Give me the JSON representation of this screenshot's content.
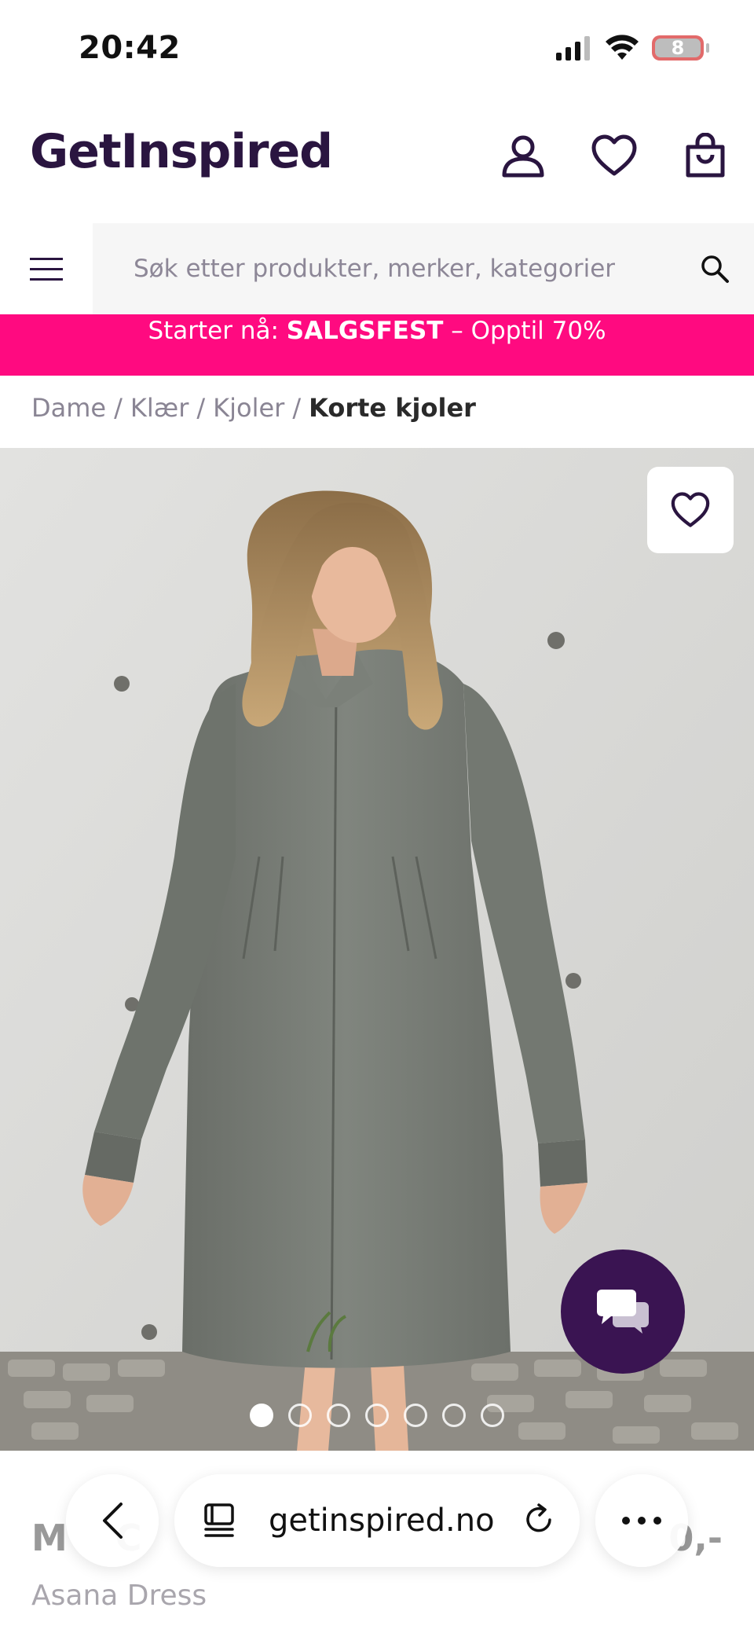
{
  "status_bar": {
    "time": "20:42",
    "battery_level": "8",
    "icons": [
      "signal-icon",
      "wifi-icon",
      "battery-icon"
    ]
  },
  "header": {
    "logo": "GetInspired",
    "icons": [
      "account-icon",
      "heart-icon",
      "bag-icon"
    ]
  },
  "search": {
    "placeholder": "Søk etter produkter, merker, kategorier"
  },
  "promo": {
    "prefix": "Starter nå: ",
    "highlight": "SALGSFEST",
    "suffix": " – Opptil 70%"
  },
  "breadcrumb": {
    "items": [
      "Dame",
      "Klær",
      "Kjoler"
    ],
    "current": "Korte kjoler",
    "separator": "/"
  },
  "gallery": {
    "image_count": 7,
    "active_index": 0
  },
  "product": {
    "brand_partial": "M",
    "brand_tail": "C",
    "price_partial": "0,-",
    "name": "Asana Dress"
  },
  "browser": {
    "url": "getinspired.no"
  },
  "colors": {
    "brand": "#2a1540",
    "promo": "#ff0a80",
    "chat": "#3a1452"
  }
}
